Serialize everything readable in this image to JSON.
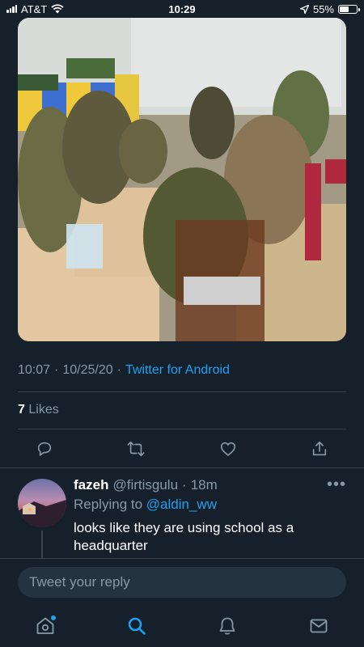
{
  "status_bar": {
    "carrier": "AT&T",
    "time": "10:29",
    "battery": "55%",
    "battery_level": 0.55
  },
  "tweet": {
    "photo_icon": "photo",
    "timestamp_time": "10:07",
    "sep1": "·",
    "timestamp_date": "10/25/20",
    "sep2": "·",
    "source": "Twitter for Android",
    "likes_count": "7",
    "likes_label": "Likes"
  },
  "actions": [
    {
      "name": "reply",
      "icon": "comment-icon"
    },
    {
      "name": "retweet",
      "icon": "retweet-icon"
    },
    {
      "name": "like",
      "icon": "heart-icon"
    },
    {
      "name": "share",
      "icon": "share-icon"
    }
  ],
  "reply": {
    "name": "fazeh",
    "handle": "@firtisgulu",
    "dot": "·",
    "time": "18m",
    "more": "•••",
    "replying_prefix": "Replying to",
    "replying_to": "@aldin_ww",
    "text": "looks like they are using school as a headquarter"
  },
  "compose": {
    "placeholder": "Tweet your reply"
  },
  "tab_bar": [
    {
      "name": "home",
      "icon": "home-icon"
    },
    {
      "name": "search",
      "icon": "search-icon",
      "active": true
    },
    {
      "name": "notifications",
      "icon": "bell-icon"
    },
    {
      "name": "messages",
      "icon": "mail-icon"
    }
  ],
  "colors": {
    "background": "#15202b",
    "accent": "#1da1f2",
    "secondary_text": "#8899a6",
    "divider": "#38444d"
  }
}
